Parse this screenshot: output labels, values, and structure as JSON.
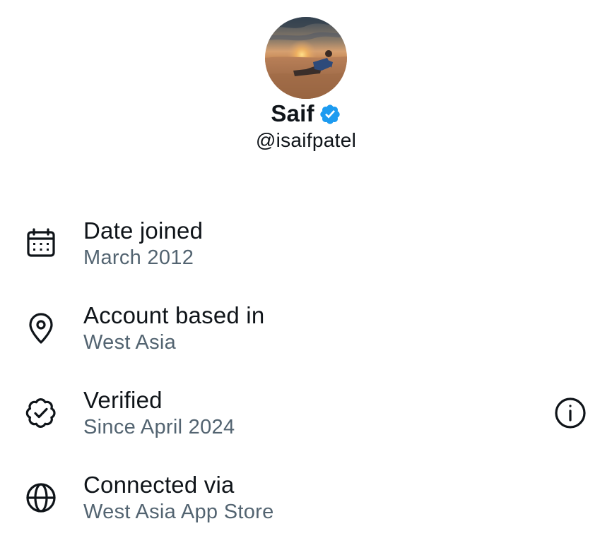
{
  "profile": {
    "display_name": "Saif",
    "handle": "@isaifpatel",
    "verified": true,
    "badge_color": "#1d9bf0"
  },
  "about_rows": [
    {
      "icon": "calendar-icon",
      "title": "Date joined",
      "value": "March 2012"
    },
    {
      "icon": "location-pin-icon",
      "title": "Account based in",
      "value": "West Asia"
    },
    {
      "icon": "verified-badge-outline-icon",
      "title": "Verified",
      "value": "Since April 2024",
      "action_icon": "info-icon"
    },
    {
      "icon": "globe-icon",
      "title": "Connected via",
      "value": "West Asia App Store"
    }
  ],
  "colors": {
    "primary_text": "#0f1419",
    "secondary_text": "#536471",
    "background": "#ffffff"
  }
}
